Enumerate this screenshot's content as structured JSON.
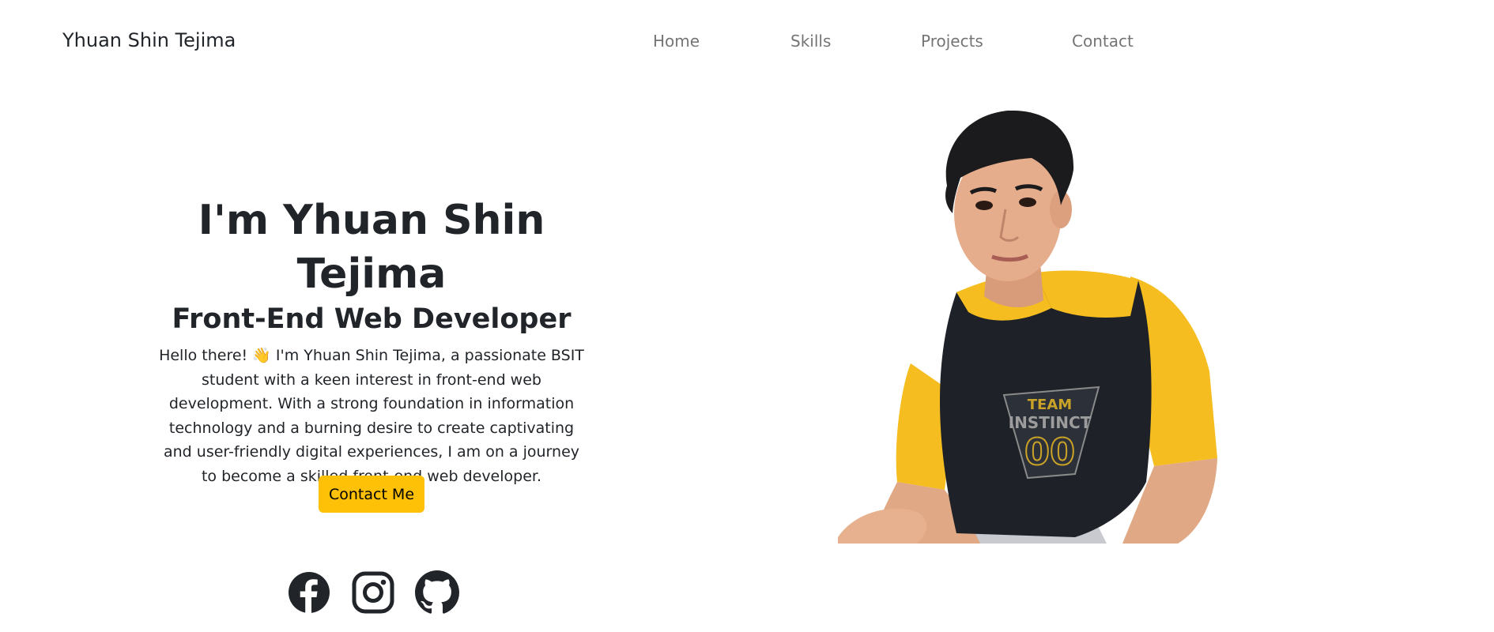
{
  "navbar": {
    "brand": "Yhuan Shin Tejima",
    "links": [
      "Home",
      "Skills",
      "Projects",
      "Contact"
    ]
  },
  "hero": {
    "title": "I'm Yhuan Shin Tejima",
    "subtitle": "Front-End Web Developer",
    "description": "Hello there! 👋 I'm Yhuan Shin Tejima, a passionate BSIT student with a keen interest in front-end web development. With a strong foundation in information technology and a burning desire to create captivating and user-friendly digital experiences, I am on a journey to become a skilled front-end web developer.",
    "contact_button": "Contact Me",
    "shirt_text": {
      "top": "TEAM",
      "middle": "INSTINCT",
      "number": "00"
    }
  },
  "social": [
    {
      "icon": "facebook-icon"
    },
    {
      "icon": "instagram-icon"
    },
    {
      "icon": "github-icon"
    }
  ],
  "colors": {
    "accent": "#ffc107",
    "text": "#212529",
    "nav_link": "#8c8c8c",
    "shirt_yellow": "#f5bd1f",
    "shirt_dark": "#1e2228"
  }
}
